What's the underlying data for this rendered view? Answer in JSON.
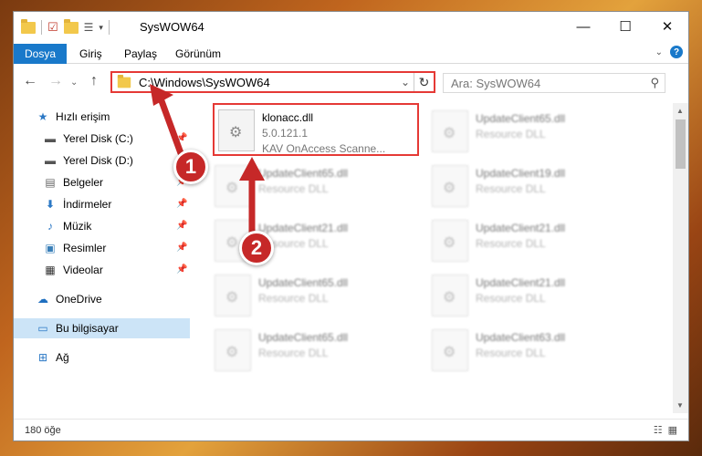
{
  "window": {
    "title": "SysWOW64"
  },
  "ribbon": {
    "tabs": [
      {
        "label": "Dosya"
      },
      {
        "label": "Giriş"
      },
      {
        "label": "Paylaş"
      },
      {
        "label": "Görünüm"
      }
    ]
  },
  "nav": {
    "address": "C:\\Windows\\SysWOW64",
    "search_placeholder": "Ara: SysWOW64"
  },
  "sidebar": {
    "items": [
      {
        "label": "Hızlı erişim",
        "icon": "star-icon"
      },
      {
        "label": "Yerel Disk (C:)",
        "icon": "drive-icon",
        "pinned": true
      },
      {
        "label": "Yerel Disk (D:)",
        "icon": "drive-icon"
      },
      {
        "label": "Belgeler",
        "icon": "documents-icon",
        "pinned": true
      },
      {
        "label": "İndirmeler",
        "icon": "download-icon",
        "pinned": true
      },
      {
        "label": "Müzik",
        "icon": "music-icon",
        "pinned": true
      },
      {
        "label": "Resimler",
        "icon": "pictures-icon",
        "pinned": true
      },
      {
        "label": "Videolar",
        "icon": "videos-icon",
        "pinned": true
      },
      {
        "label": "OneDrive",
        "icon": "cloud-icon"
      },
      {
        "label": "Bu bilgisayar",
        "icon": "computer-icon",
        "selected": true
      },
      {
        "label": "Ağ",
        "icon": "network-icon"
      }
    ]
  },
  "files": {
    "highlighted": {
      "name": "klonacc.dll",
      "version": "5.0.121.1",
      "desc": "KAV OnAccess Scanne..."
    },
    "tiles": [
      {
        "name": "UpdateClient65.dll",
        "desc": "Resource DLL"
      },
      {
        "name": "UpdateClient65.dll",
        "desc": "Resource DLL"
      },
      {
        "name": "UpdateClient19.dll",
        "desc": "Resource DLL"
      },
      {
        "name": "UpdateClient21.dll",
        "desc": "Resource DLL"
      },
      {
        "name": "UpdateClient21.dll",
        "desc": "Resource DLL"
      },
      {
        "name": "UpdateClient65.dll",
        "desc": "Resource DLL"
      },
      {
        "name": "UpdateClient21.dll",
        "desc": "Resource DLL"
      },
      {
        "name": "UpdateClient65.dll",
        "desc": "Resource DLL"
      },
      {
        "name": "UpdateClient63.dll",
        "desc": "Resource DLL"
      }
    ]
  },
  "status": {
    "count": "180 öğe"
  },
  "annotations": {
    "badge1": "1",
    "badge2": "2"
  },
  "colors": {
    "accent": "#1979ca",
    "highlight": "#e53935",
    "badge": "#c62828"
  }
}
